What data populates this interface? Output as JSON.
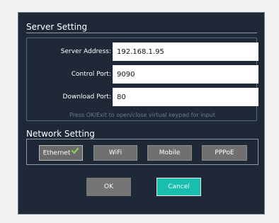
{
  "server": {
    "title": "Server Setting",
    "fields": [
      {
        "label": "Server Address:",
        "value": "192.168.1.95"
      },
      {
        "label": "Control Port:",
        "value": "9090"
      },
      {
        "label": "Download Port:",
        "value": "80"
      }
    ],
    "hint": "Press OK/Exit to open/close virtual keypad for input"
  },
  "network": {
    "title": "Network Setting",
    "options": [
      {
        "label": "Ethernet",
        "selected": true
      },
      {
        "label": "WiFi",
        "selected": false
      },
      {
        "label": "Mobile",
        "selected": false
      },
      {
        "label": "PPPoE",
        "selected": false
      }
    ]
  },
  "actions": {
    "ok_label": "OK",
    "cancel_label": "Cancel"
  },
  "colors": {
    "dialog_bg": "#1f2837",
    "cancel_accent": "#18bfae",
    "check_green": "#8fd14f"
  },
  "icons": {
    "selected_network": "check-icon"
  }
}
